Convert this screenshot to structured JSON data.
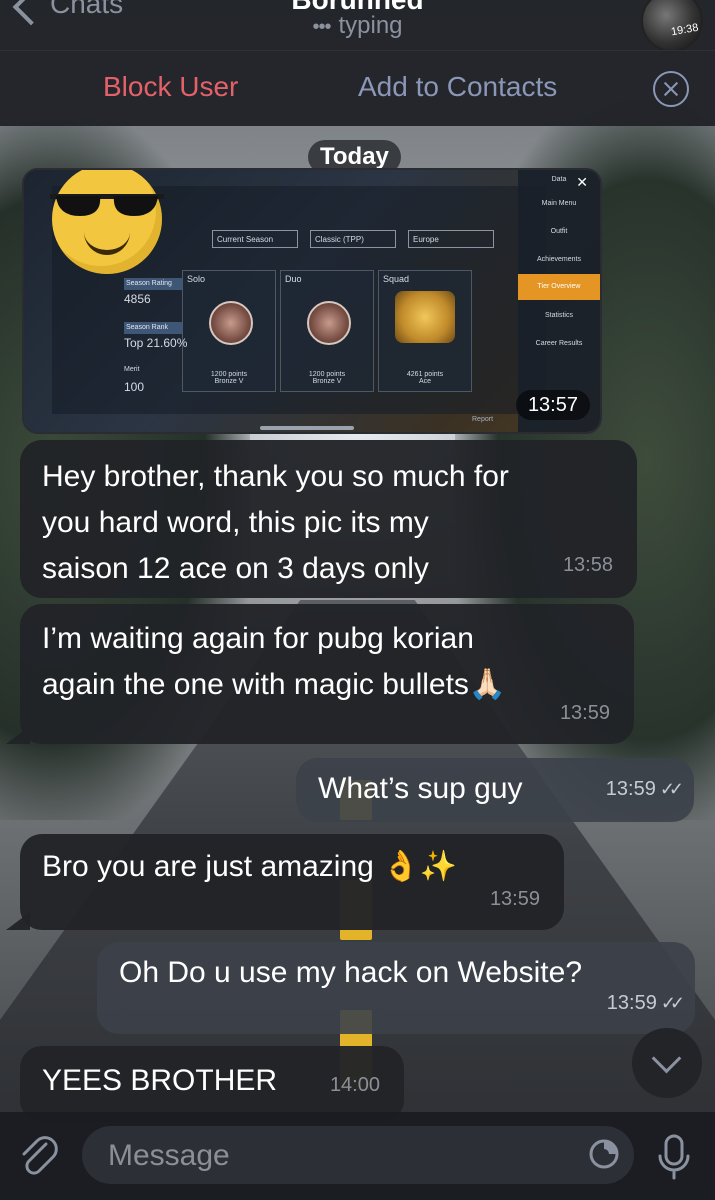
{
  "header": {
    "back_label": "Chats",
    "title": "Boruhhed",
    "status": "typing",
    "avatar_stamp": "19:38"
  },
  "actions": {
    "block": "Block User",
    "add_contact": "Add to Contacts"
  },
  "chat": {
    "date": "Today",
    "photo": {
      "time": "13:57",
      "dropdowns": [
        "Current Season",
        "Classic (TPP)",
        "Europe"
      ],
      "modes": [
        {
          "label": "Solo",
          "points": "1200 points",
          "tier": "Bronze V"
        },
        {
          "label": "Duo",
          "points": "1200 points",
          "tier": "Bronze V"
        },
        {
          "label": "Squad",
          "points": "4261 points",
          "tier": "Ace"
        }
      ],
      "stats": {
        "rating_label": "Season Rating",
        "rating": "4856",
        "rank_label": "Season Rank",
        "rank": "Top 21.60%",
        "merit_label": "Merit",
        "merit": "100"
      },
      "menu": [
        "Data",
        "Main Menu",
        "Outfit",
        "Achievements",
        "Tier Overview",
        "Statistics",
        "Career Results"
      ],
      "report": "Report"
    },
    "messages": [
      {
        "dir": "in",
        "text": "Hey brother, thank you so much for\nyou hard word, this pic its my\nsaison 12 ace on 3 days only",
        "time": "13:58"
      },
      {
        "dir": "in",
        "text": "I’m waiting again for pubg korian\nagain the one with magic bullets🙏🏻",
        "time": "13:59"
      },
      {
        "dir": "out",
        "text": "What’s sup guy",
        "time": "13:59"
      },
      {
        "dir": "in",
        "text": "Bro you are just amazing 👌✨",
        "time": "13:59"
      },
      {
        "dir": "out",
        "text": "Oh Do u use my hack on Website?",
        "time": "13:59"
      },
      {
        "dir": "in",
        "text": "YEES BROTHER",
        "time": "14:00"
      }
    ]
  },
  "composer": {
    "placeholder": "Message"
  },
  "colors": {
    "block": "#e5616a",
    "link": "#8a97b6",
    "bubble_in": "#212328",
    "bubble_out": "#3c414a"
  }
}
